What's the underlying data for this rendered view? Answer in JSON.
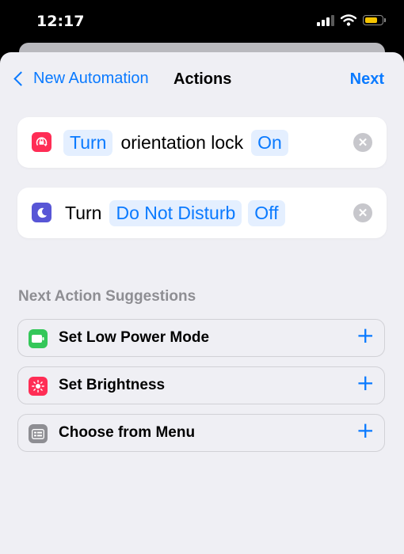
{
  "status_bar": {
    "time": "12:17"
  },
  "nav": {
    "back_label": "New Automation",
    "title": "Actions",
    "next_label": "Next"
  },
  "actions": [
    {
      "icon": "orientation-lock-icon",
      "icon_color": "#ff2d55",
      "prefix": "Turn",
      "text": "orientation lock",
      "value": "On"
    },
    {
      "icon": "moon-icon",
      "icon_color": "#5856d6",
      "prefix": "Turn",
      "text": "Do Not Disturb",
      "value": "Off"
    }
  ],
  "suggestions": {
    "header": "Next Action Suggestions",
    "items": [
      {
        "label": "Set Low Power Mode",
        "icon": "battery-icon",
        "icon_color": "#34c759"
      },
      {
        "label": "Set Brightness",
        "icon": "brightness-icon",
        "icon_color": "#ff2d55"
      },
      {
        "label": "Choose from Menu",
        "icon": "menu-icon",
        "icon_color": "#8e8e93"
      }
    ]
  },
  "colors": {
    "accent": "#0a7aff",
    "background": "#efeff4",
    "token_background": "#e4efff"
  }
}
